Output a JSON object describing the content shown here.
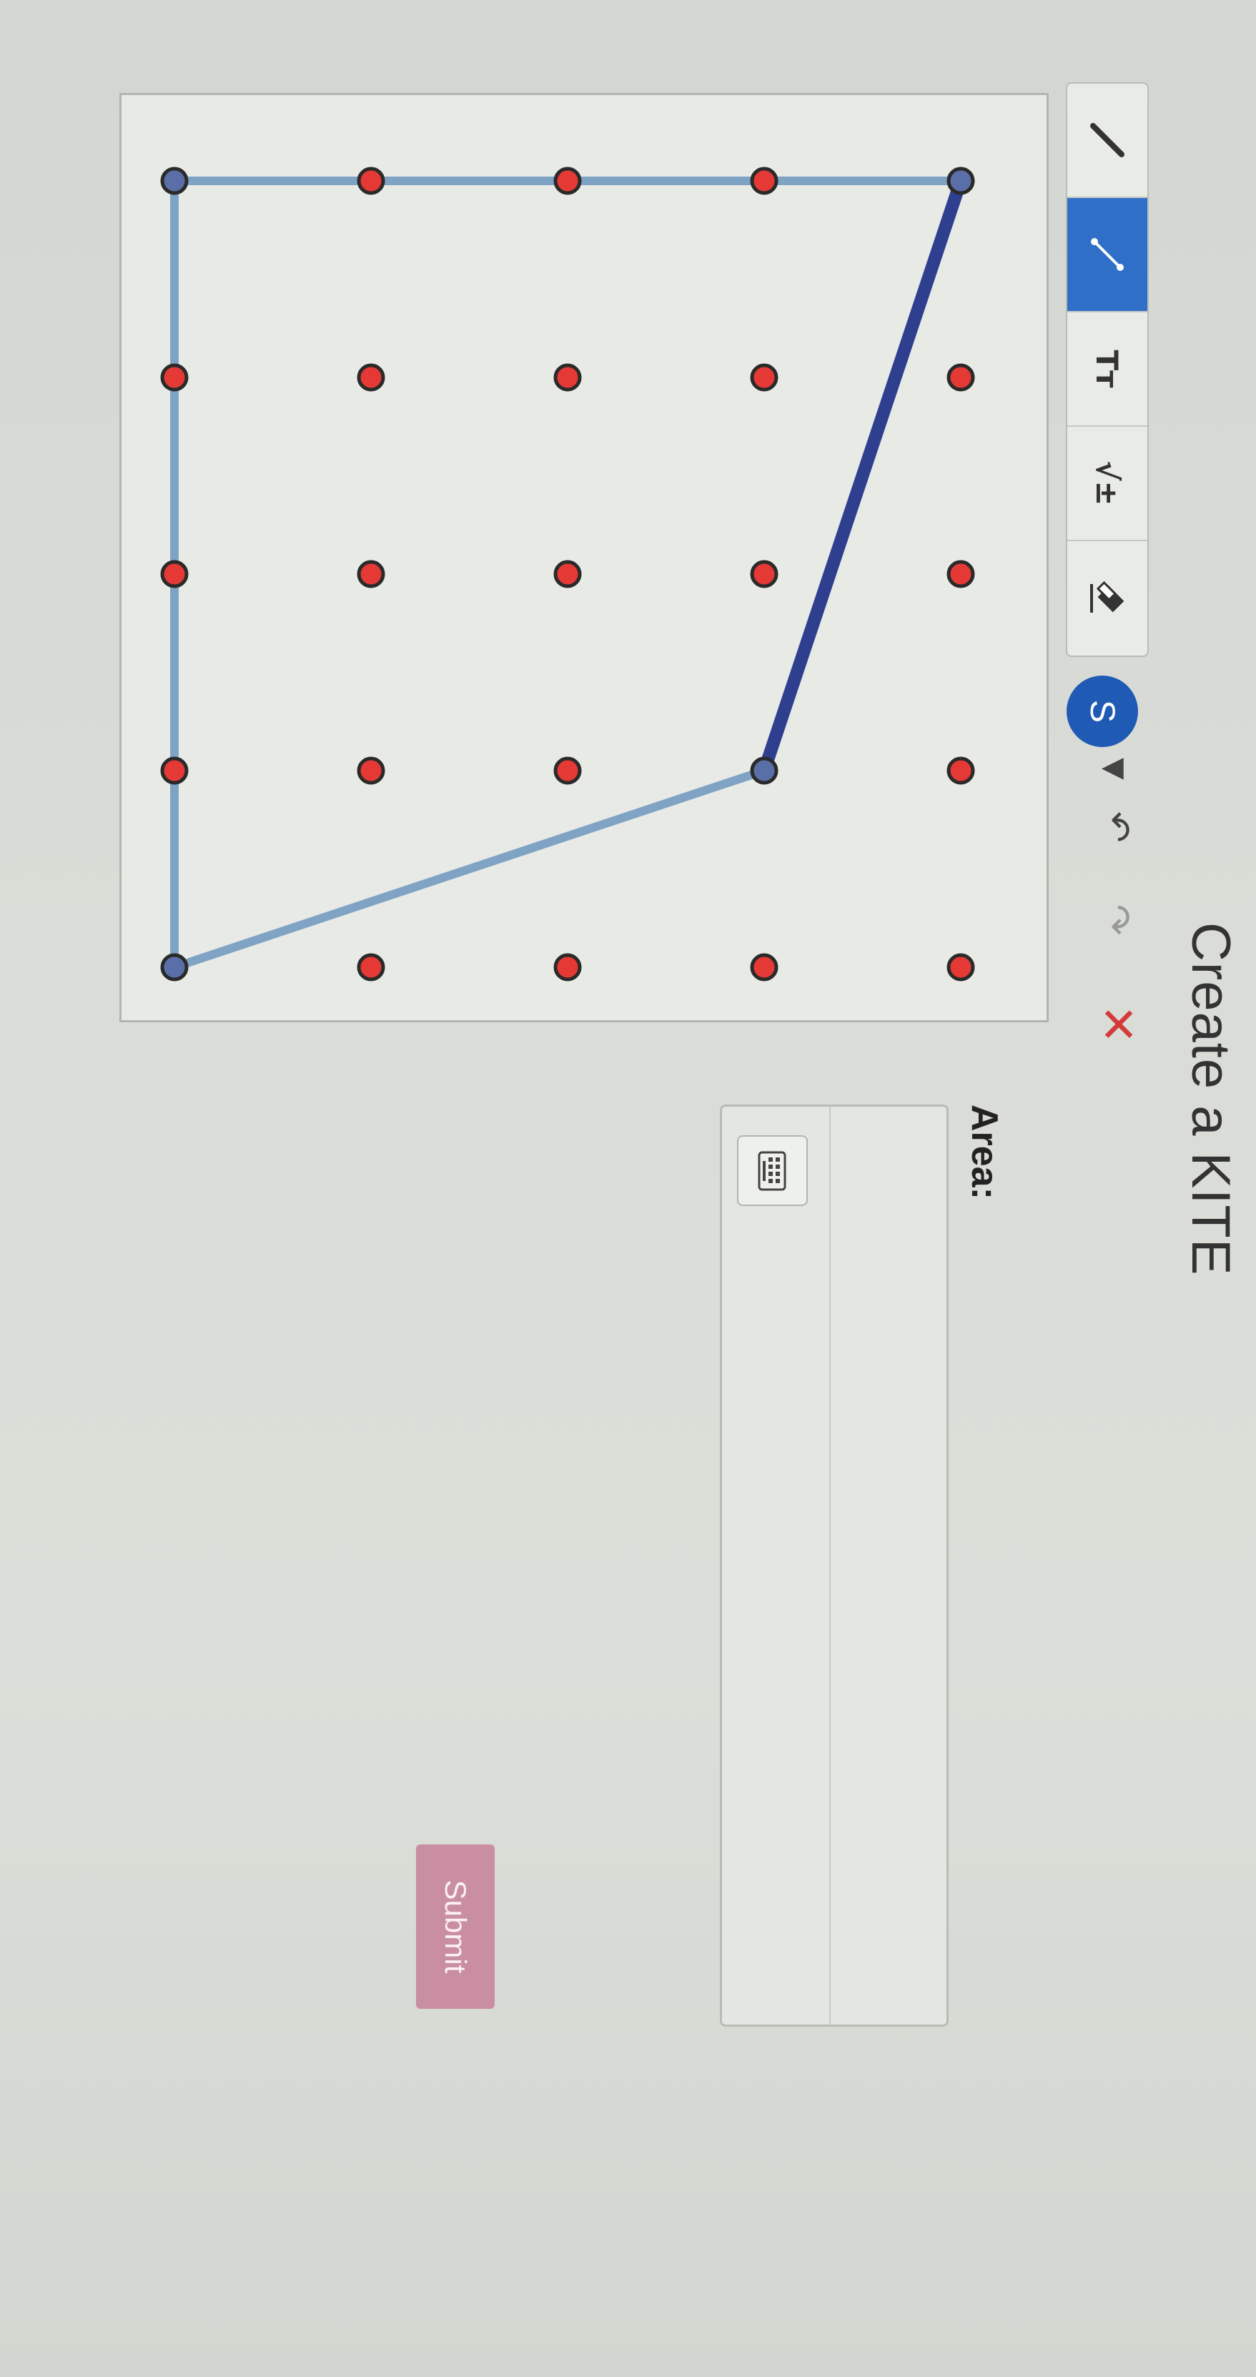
{
  "header": {
    "title": "Create a KITE"
  },
  "toolbar": {
    "tools": [
      {
        "name": "pencil",
        "icon": "pencil-icon"
      },
      {
        "name": "segment",
        "icon": "line-segment-icon",
        "active": true
      },
      {
        "name": "text",
        "icon": "text-tool-icon",
        "label": "Tт"
      },
      {
        "name": "math",
        "icon": "math-tool-icon",
        "label": "√±"
      },
      {
        "name": "eraser",
        "icon": "eraser-icon"
      }
    ],
    "user_badge": "S",
    "undo_icon": "undo-icon",
    "redo_icon": "redo-icon",
    "close_icon": "close-icon"
  },
  "board": {
    "grid": {
      "rows": 5,
      "cols": 5
    },
    "dot_color": "#e53935",
    "segments": [
      {
        "from": [
          0,
          0
        ],
        "to": [
          1,
          3
        ],
        "color": "#2e3f8f"
      },
      {
        "from": [
          1,
          3
        ],
        "to": [
          4,
          4
        ],
        "color": "#7fa3c4"
      },
      {
        "from": [
          4,
          4
        ],
        "to": [
          4,
          0
        ],
        "color": "#7fa3c4"
      },
      {
        "from": [
          4,
          0
        ],
        "to": [
          0,
          0
        ],
        "color": "#7fa3c4"
      }
    ]
  },
  "answer": {
    "label": "Area:",
    "keyboard_icon": "keyboard-icon",
    "submit_label": "Submit"
  }
}
